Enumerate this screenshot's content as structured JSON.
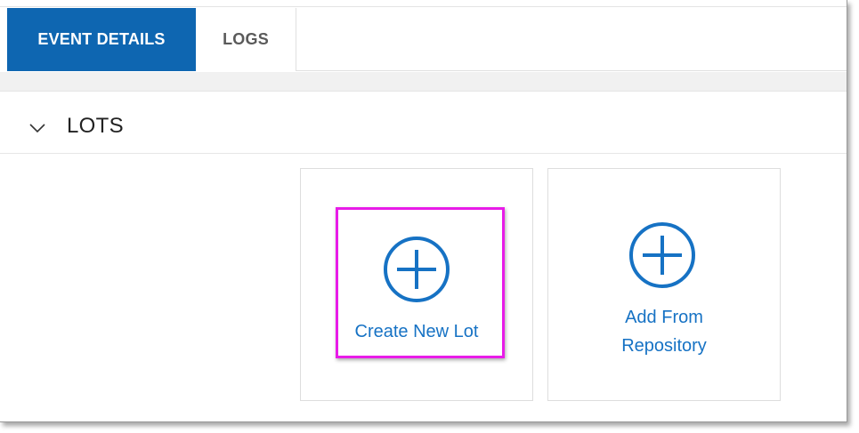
{
  "tabs": [
    {
      "label": "EVENT DETAILS",
      "active": true
    },
    {
      "label": "LOGS",
      "active": false
    }
  ],
  "section": {
    "title": "LOTS",
    "expanded": true,
    "toggle_icon": "chevron-down-icon"
  },
  "actions": {
    "create_new_lot": {
      "label": "Create New Lot",
      "icon": "plus-circle-icon"
    },
    "add_from_repository": {
      "label_line1": "Add From",
      "label_line2": "Repository",
      "icon": "plus-circle-icon"
    }
  },
  "colors": {
    "active_tab_bg": "#0e66b1",
    "accent": "#1672c4",
    "highlight": "#e81ce8"
  }
}
